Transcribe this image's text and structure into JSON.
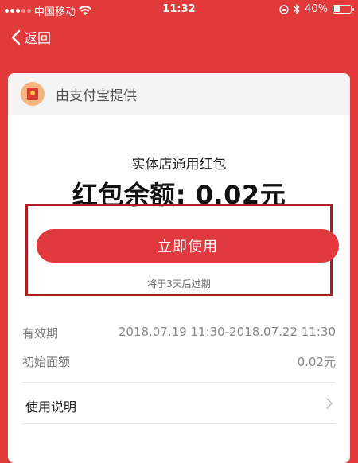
{
  "status_bar": {
    "carrier": "中国移动",
    "time": "11:32",
    "battery": "40%",
    "battery_level": 0.4
  },
  "nav": {
    "back_label": "返回"
  },
  "provider": {
    "text": "由支付宝提供"
  },
  "envelope": {
    "title": "实体店通用红包",
    "balance": "红包余额: 0.02元",
    "use_button_label": "立即使用",
    "expire_note": "将于3天后过期"
  },
  "details": {
    "validity_label": "有效期",
    "validity_value": "2018.07.19 11:30-2018.07.22 11:30",
    "initial_label": "初始面额",
    "initial_value": "0.02元"
  },
  "instructions": {
    "label": "使用说明"
  },
  "colors": {
    "background": "#e23a3a",
    "button": "#e2393e",
    "highlight_border": "#b01e22"
  }
}
